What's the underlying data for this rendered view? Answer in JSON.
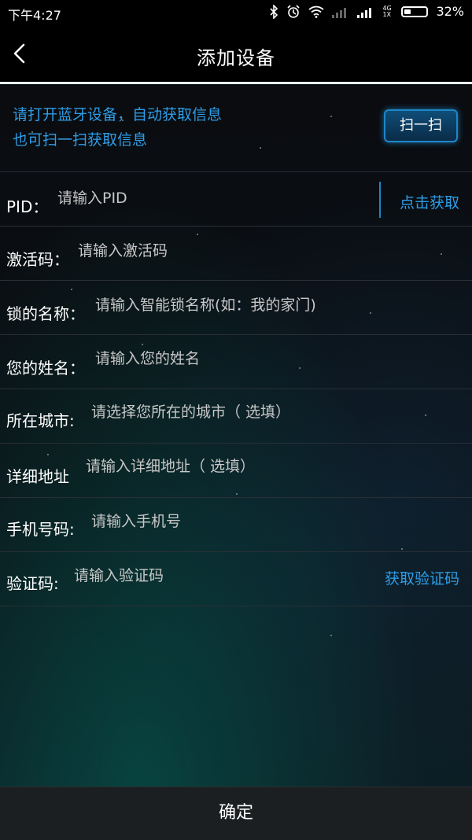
{
  "status_bar": {
    "time": "下午4:27",
    "network": "4G 1X",
    "battery": "32%",
    "battery_level": 0.32
  },
  "header": {
    "title": "添加设备"
  },
  "banner": {
    "line1": "请打开蓝牙设备，自动获取信息",
    "line2": "也可扫一扫获取信息",
    "scan_label": "扫一扫"
  },
  "form": {
    "pid": {
      "label": "PID：",
      "placeholder": "请输入PID",
      "action": "点击获取"
    },
    "activation_code": {
      "label": "激活码：",
      "placeholder": "请输入激活码"
    },
    "lock_name": {
      "label": "锁的名称：",
      "placeholder": "请输入智能锁名称(如：我的家门)"
    },
    "your_name": {
      "label": "您的姓名：",
      "placeholder": "请输入您的姓名"
    },
    "city": {
      "label": "所在城市:",
      "placeholder": "请选择您所在的城市（ 选填）"
    },
    "address": {
      "label": "详细地址",
      "placeholder": "请输入详细地址（ 选填）"
    },
    "phone": {
      "label": "手机号码:",
      "placeholder": "请输入手机号"
    },
    "verify_code": {
      "label": "验证码:",
      "placeholder": "请输入验证码",
      "action": "获取验证码"
    }
  },
  "footer": {
    "confirm_label": "确定"
  },
  "colors": {
    "accent": "#2d9de6",
    "background": "#06090d",
    "bottom_bar": "#1c1f22"
  }
}
